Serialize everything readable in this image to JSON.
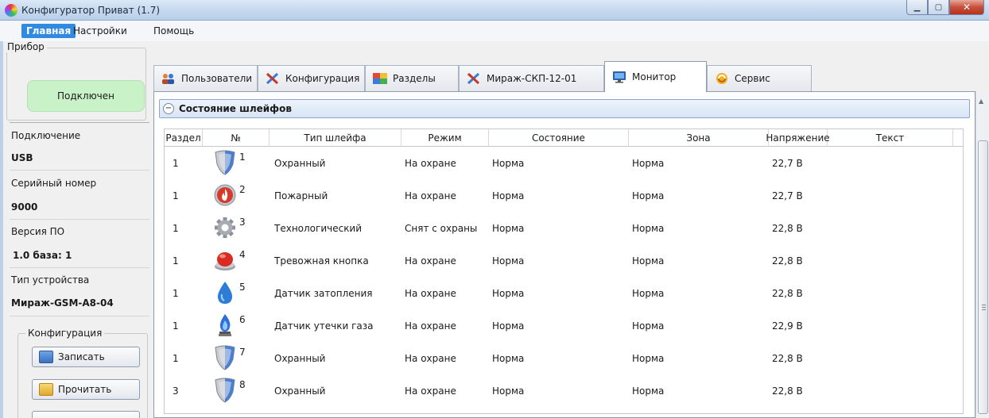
{
  "window": {
    "title": "Конфигуратор Приват (1.7)",
    "buttons": [
      "minimize",
      "maximize",
      "close"
    ]
  },
  "menu": [
    {
      "label": "Главная",
      "active": true
    },
    {
      "label": "Настройки",
      "active": false
    },
    {
      "label": "Помощь",
      "active": false
    }
  ],
  "device": {
    "group_label": "Прибор",
    "status": "Подключен",
    "connection_label": "Подключение",
    "connection_value": "USB",
    "serial_label": "Серийный номер",
    "serial_value": "9000",
    "firmware_label": "Версия ПО",
    "firmware_value": "1.0 база: 1",
    "type_label": "Тип устройства",
    "type_value": "Мираж-GSM-A8-04"
  },
  "config": {
    "group_label": "Конфигурация",
    "write_label": "Записать",
    "read_label": "Прочитать"
  },
  "tabs": [
    {
      "label": "Пользователи",
      "icon": "users-icon",
      "active": false
    },
    {
      "label": "Конфигурация",
      "icon": "tools-icon",
      "active": false
    },
    {
      "label": "Разделы",
      "icon": "sections-icon",
      "active": false
    },
    {
      "label": "Мираж-СКП-12-01",
      "icon": "tools-icon",
      "active": false
    },
    {
      "label": "Монитор",
      "icon": "monitor-icon",
      "active": true
    },
    {
      "label": "Сервис",
      "icon": "service-icon",
      "active": false
    }
  ],
  "section": {
    "title": "Состояние шлейфов"
  },
  "table": {
    "columns": [
      "Раздел",
      "№",
      "Тип шлейфа",
      "Режим",
      "Состояние",
      "Зона",
      "Напряжение",
      "Текст"
    ],
    "rows": [
      {
        "section": "1",
        "num": "1",
        "icon": "shield-icon",
        "type": "Охранный",
        "mode": "На охране",
        "state": "Норма",
        "zone": "Норма",
        "voltage": "22,7 В",
        "text": ""
      },
      {
        "section": "1",
        "num": "2",
        "icon": "fire-icon",
        "type": "Пожарный",
        "mode": "На охране",
        "state": "Норма",
        "zone": "Норма",
        "voltage": "22,7 В",
        "text": ""
      },
      {
        "section": "1",
        "num": "3",
        "icon": "gear-icon",
        "type": "Технологический",
        "mode": "Снят с охраны",
        "state": "Норма",
        "zone": "Норма",
        "voltage": "22,8 В",
        "text": ""
      },
      {
        "section": "1",
        "num": "4",
        "icon": "alarm-button-icon",
        "type": "Тревожная кнопка",
        "mode": "На охране",
        "state": "Норма",
        "zone": "Норма",
        "voltage": "22,8 В",
        "text": ""
      },
      {
        "section": "1",
        "num": "5",
        "icon": "water-drop-icon",
        "type": "Датчик затопления",
        "mode": "На охране",
        "state": "Норма",
        "zone": "Норма",
        "voltage": "22,8 В",
        "text": ""
      },
      {
        "section": "1",
        "num": "6",
        "icon": "gas-flame-icon",
        "type": "Датчик утечки газа",
        "mode": "На охране",
        "state": "Норма",
        "zone": "Норма",
        "voltage": "22,9 В",
        "text": ""
      },
      {
        "section": "1",
        "num": "7",
        "icon": "shield-icon",
        "type": "Охранный",
        "mode": "На охране",
        "state": "Норма",
        "zone": "Норма",
        "voltage": "22,8 В",
        "text": ""
      },
      {
        "section": "3",
        "num": "8",
        "icon": "shield-icon",
        "type": "Охранный",
        "mode": "На охране",
        "state": "Норма",
        "zone": "Норма",
        "voltage": "22,8 В",
        "text": ""
      }
    ]
  }
}
